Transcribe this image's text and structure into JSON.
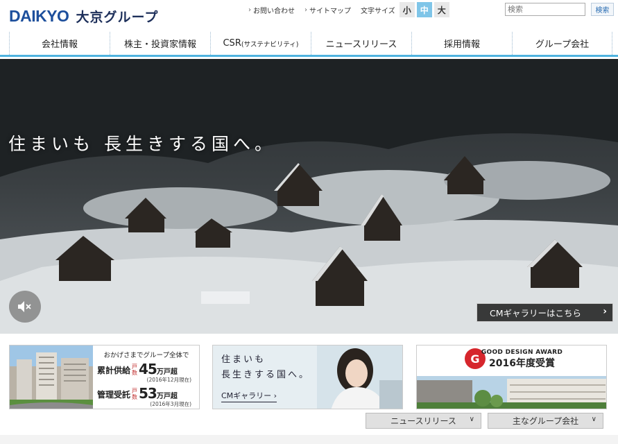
{
  "brand": {
    "logo_en": "DAIKYO",
    "logo_jp": "大京グループ",
    "primary_color": "#1d4f9c",
    "accent_color": "#e78a1b"
  },
  "utility": {
    "contact": "お問い合わせ",
    "sitemap": "サイトマップ",
    "font_size_label": "文字サイズ",
    "font_sizes": [
      "小",
      "中",
      "大"
    ],
    "font_size_selected": "中"
  },
  "search": {
    "placeholder": "検索",
    "button": "検索"
  },
  "nav": {
    "items": [
      "会社情報",
      "株主・投資家情報",
      "CSR",
      "(サステナビリティ)",
      "ニュースリリース",
      "採用情報",
      "グループ会社"
    ]
  },
  "hero": {
    "copy": "住まいも 長生きする国へ。",
    "cm_button": "CMギャラリーはこちら",
    "mute_icon": "speaker-mute-icon"
  },
  "banners": {
    "supply": {
      "caption": "おかげさまでグループ全体で",
      "row1_label": "累計供給",
      "row1_unit": "戸数",
      "row1_value": "45",
      "row1_suffix": "万戸超",
      "row1_note": "(2016年12月現在)",
      "row2_label": "管理受託",
      "row2_unit": "戸数",
      "row2_value": "53",
      "row2_suffix": "万戸超",
      "row2_note": "(2016年3月現在)"
    },
    "cm": {
      "line1": "住まいも",
      "line2": "長生きする国へ。",
      "link": "CMギャラリー ›"
    },
    "gda": {
      "mark": "G",
      "award": "GOOD DESIGN AWARD",
      "year": "2016年度受賞"
    }
  },
  "selects": {
    "news": "ニュースリリース",
    "group": "主なグループ会社"
  }
}
